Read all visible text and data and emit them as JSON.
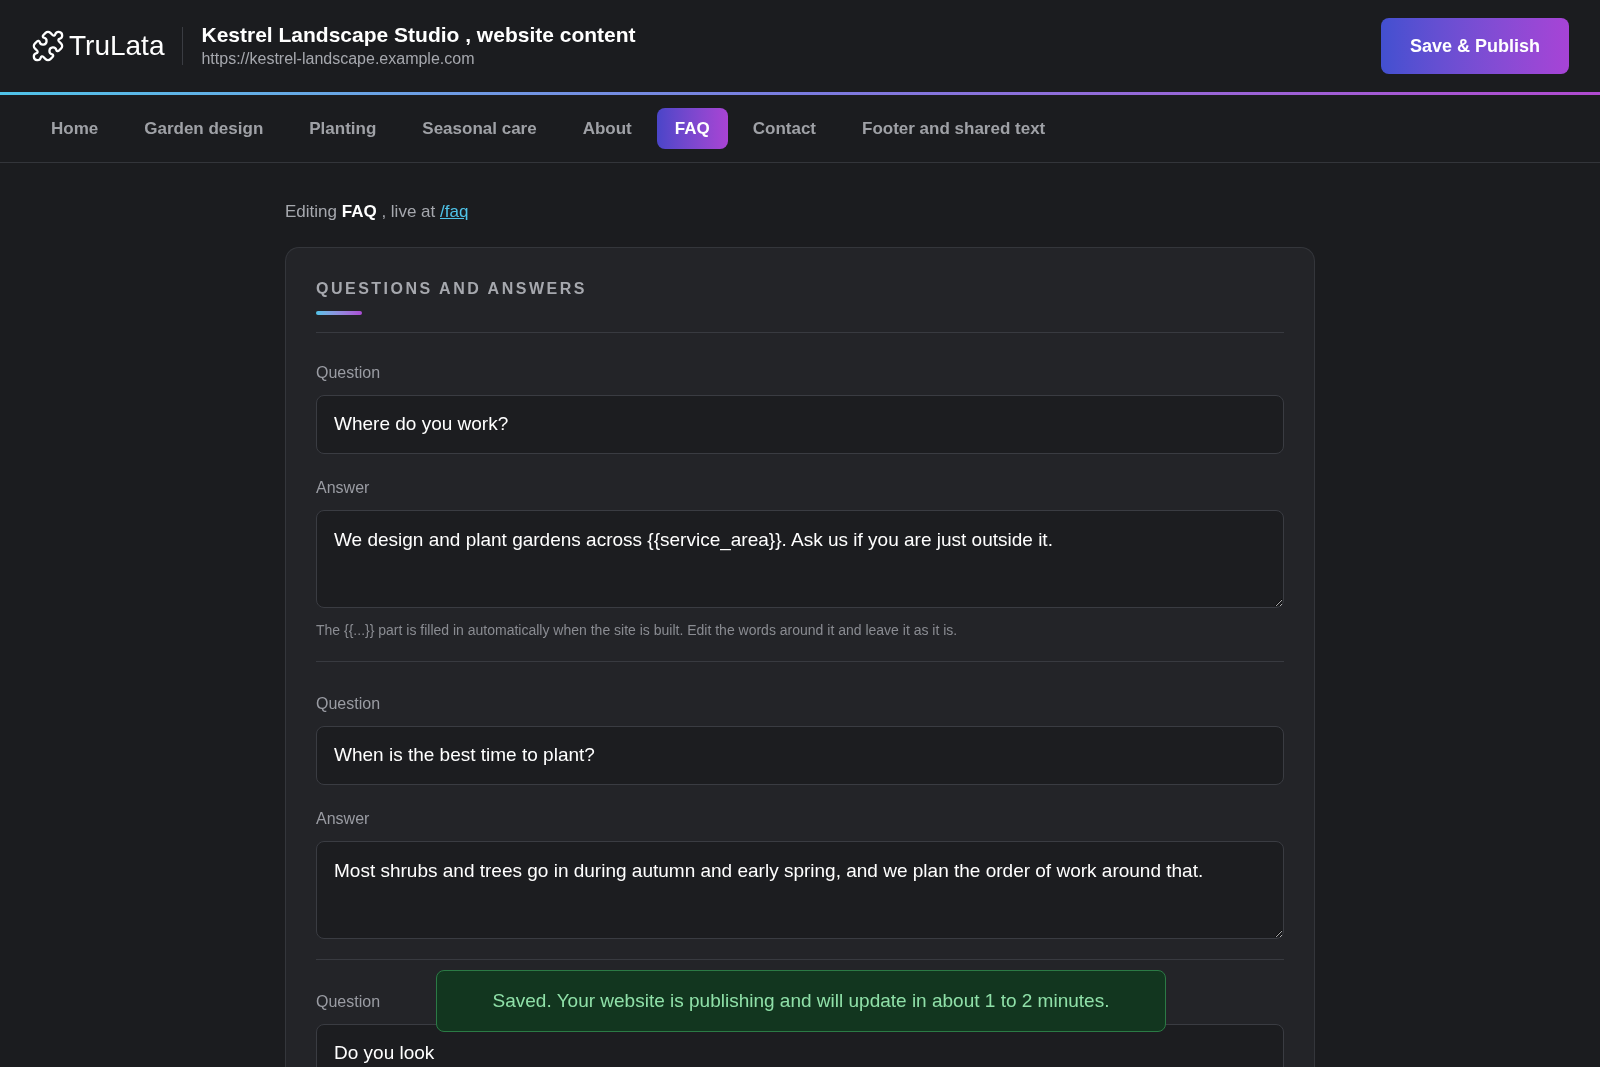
{
  "header": {
    "logo": "TruLata",
    "title": "Kestrel Landscape Studio , website content",
    "url": "https://kestrel-landscape.example.com",
    "publish_button": "Save & Publish"
  },
  "tabs": [
    {
      "label": "Home",
      "selected": false
    },
    {
      "label": "Garden design",
      "selected": false
    },
    {
      "label": "Planting",
      "selected": false
    },
    {
      "label": "Seasonal care",
      "selected": false
    },
    {
      "label": "About",
      "selected": false
    },
    {
      "label": "FAQ",
      "selected": true
    },
    {
      "label": "Contact",
      "selected": false
    },
    {
      "label": "Footer and shared text",
      "selected": false
    }
  ],
  "editing": {
    "text": "Editing **FAQ** , live at",
    "link": "/faq"
  },
  "section": {
    "title": "QUESTIONS AND ANSWERS",
    "items": [
      {
        "question_label": "Question",
        "question": "Where do you work?",
        "answer_label": "Answer",
        "answer": "We design and plant gardens across {{service_area}}. Ask us if you are just outside it.",
        "hint": "The {{...}} part is filled in automatically when the site is built. Edit the words around it and leave it as it is."
      },
      {
        "question_label": "Question",
        "question": "When is the best time to plant?",
        "answer_label": "Answer",
        "answer": "Most shrubs and trees go in during autumn and early spring, and we plan the order of work around that."
      },
      {
        "question_label": "Question",
        "question": "Do you look"
      }
    ]
  },
  "toast": "Saved. Your website is publishing and will update in about 1 to 2 minutes."
}
